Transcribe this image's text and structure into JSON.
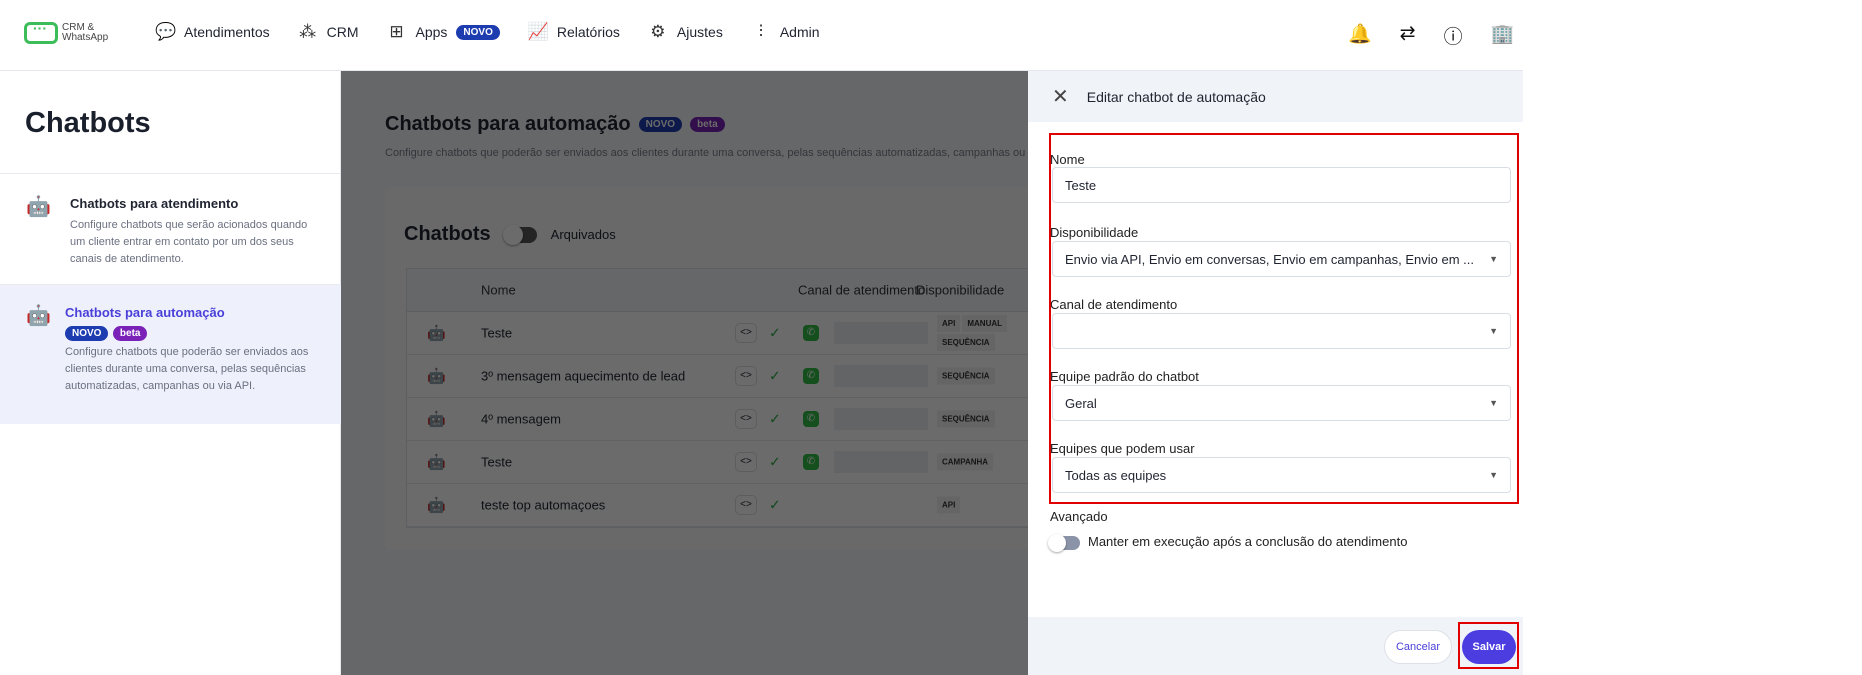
{
  "topbar": {
    "logo_text": "CRM & WhatsApp",
    "nav": [
      {
        "label": "Atendimentos",
        "icon": "chat-bubble-icon"
      },
      {
        "label": "CRM",
        "icon": "nodes-icon"
      },
      {
        "label": "Apps",
        "icon": "grid-icon",
        "badge": "NOVO"
      },
      {
        "label": "Relatórios",
        "icon": "chart-board-icon"
      },
      {
        "label": "Ajustes",
        "icon": "gear-icon"
      },
      {
        "label": "Admin",
        "icon": "sliders-icon"
      }
    ],
    "right_icons": [
      "bell-icon",
      "swap-arrows-icon",
      "help-icon",
      "building-icon"
    ]
  },
  "sidebar": {
    "title": "Chatbots",
    "items": [
      {
        "title": "Chatbots para atendimento",
        "desc": "Configure chatbots que serão acionados quando um cliente entrar em contato por um dos seus canais de atendimento."
      },
      {
        "title": "Chatbots para automação",
        "badges": [
          "NOVO",
          "beta"
        ],
        "desc": "Configure chatbots que poderão ser enviados aos clientes durante uma conversa, pelas sequências automatizadas, campanhas ou via API."
      }
    ]
  },
  "main": {
    "title": "Chatbots para automação",
    "badges": [
      "NOVO",
      "beta"
    ],
    "desc": "Configure chatbots que poderão ser enviados aos clientes durante uma conversa, pelas sequências automatizadas, campanhas ou via API.",
    "card_title": "Chatbots",
    "archived_label": "Arquivados",
    "columns": [
      "Nome",
      "Canal de atendimento",
      "Disponibilidade"
    ],
    "rows": [
      {
        "name": "Teste",
        "whatsapp": true,
        "tags": [
          "API",
          "MANUAL",
          "SEQUÊNCIA"
        ]
      },
      {
        "name": "3º mensagem aquecimento de lead",
        "whatsapp": true,
        "tags": [
          "SEQUÊNCIA"
        ]
      },
      {
        "name": "4º mensagem",
        "whatsapp": true,
        "tags": [
          "SEQUÊNCIA"
        ]
      },
      {
        "name": "Teste",
        "whatsapp": true,
        "tags": [
          "CAMPANHA"
        ]
      },
      {
        "name": "teste top automaçoes",
        "whatsapp": false,
        "tags": [
          "API"
        ]
      }
    ]
  },
  "drawer": {
    "title": "Editar chatbot de automação",
    "fields": [
      {
        "label": "Nome",
        "value": "Teste"
      },
      {
        "label": "Disponibilidade",
        "value": "Envio via API, Envio em conversas, Envio em campanhas, Envio em ..."
      },
      {
        "label": "Canal de atendimento",
        "value": ""
      },
      {
        "label": "Equipe padrão do chatbot",
        "value": "Geral"
      },
      {
        "label": "Equipes que podem usar",
        "value": "Todas as equipes"
      }
    ],
    "advanced_label": "Avançado",
    "keep_running_label": "Manter em execução após a conclusão do atendimento",
    "keep_running": false,
    "cancel_label": "Cancelar",
    "save_label": "Salvar"
  },
  "colors": {
    "accent": "#4b3de0",
    "highlight": "#e00000",
    "whatsapp": "#2fbd44"
  }
}
